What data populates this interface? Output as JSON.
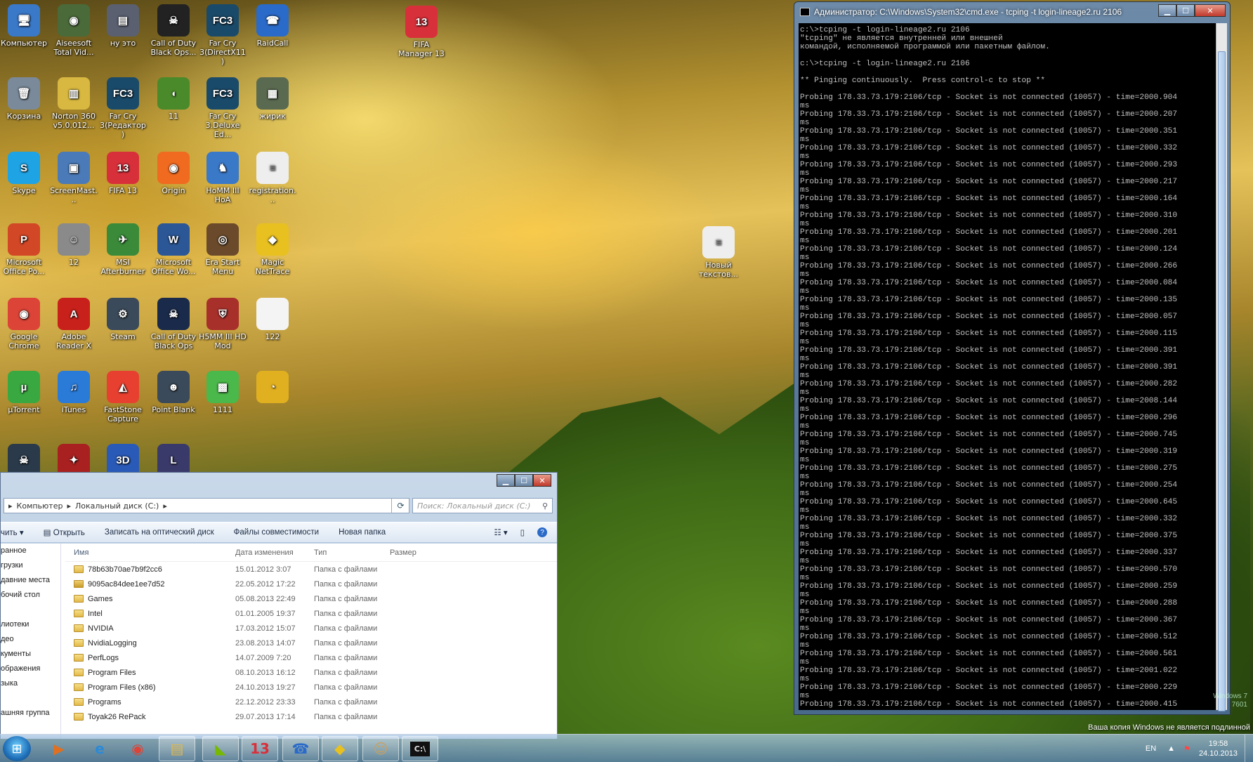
{
  "desktop_icons": [
    {
      "label": "Компьютер",
      "icon": "computer-icon",
      "color": "#3a78c8",
      "glyph": "🖥"
    },
    {
      "label": "Aiseesoft Total Vid...",
      "icon": "film-reel-icon",
      "color": "#4a6a3a",
      "glyph": "◉"
    },
    {
      "label": "ну это",
      "icon": "road-image-icon",
      "color": "#5a6070",
      "glyph": "▤"
    },
    {
      "label": "Call of Duty Black Ops...",
      "icon": "skull-icon",
      "color": "#222",
      "glyph": "☠"
    },
    {
      "label": "Far Cry 3(DirectX11)",
      "icon": "farcry3-icon",
      "color": "#1a4a6a",
      "glyph": "FC3"
    },
    {
      "label": "RaidCall",
      "icon": "raidcall-icon",
      "color": "#2a6ac8",
      "glyph": "☎"
    },
    {
      "label": "Корзина",
      "icon": "recycle-bin-icon",
      "color": "#7a8a9a",
      "glyph": "🗑"
    },
    {
      "label": "Norton 360 v5.0.012...",
      "icon": "norton-box-icon",
      "color": "#d8b840",
      "glyph": "▥"
    },
    {
      "label": "Far Cry 3(Редактор)",
      "icon": "farcry3-editor-icon",
      "color": "#1a4a6a",
      "glyph": "FC3"
    },
    {
      "label": "11",
      "icon": "cucumber-icon",
      "color": "#4a8a2a",
      "glyph": "◖"
    },
    {
      "label": "Far Cry 3.Deluxe Ed...",
      "icon": "farcry3-deluxe-icon",
      "color": "#1a4a6a",
      "glyph": "FC3"
    },
    {
      "label": "жирик",
      "icon": "photo-icon",
      "color": "#5a6a50",
      "glyph": "▦"
    },
    {
      "label": "Skype",
      "icon": "skype-icon",
      "color": "#1ea3e4",
      "glyph": "S"
    },
    {
      "label": "ScreenMast...",
      "icon": "screenmaster-icon",
      "color": "#4a7ab8",
      "glyph": "▣"
    },
    {
      "label": "FIFA 13",
      "icon": "fifa13-icon",
      "color": "#d8303a",
      "glyph": "13"
    },
    {
      "label": "Origin",
      "icon": "origin-icon",
      "color": "#f06a20",
      "glyph": "◉"
    },
    {
      "label": "HoMM III HoA",
      "icon": "homm3-icon",
      "color": "#3a78c8",
      "glyph": "♞"
    },
    {
      "label": "registration...",
      "icon": "text-file-icon",
      "color": "#eeeeee",
      "glyph": "≡"
    },
    {
      "label": "Microsoft Office Po...",
      "icon": "powerpoint-icon",
      "color": "#d24726",
      "glyph": "P"
    },
    {
      "label": "12",
      "icon": "portrait-icon",
      "color": "#8a8a8a",
      "glyph": "☺"
    },
    {
      "label": "MSI Afterburner",
      "icon": "msi-afterburner-icon",
      "color": "#3a8a3a",
      "glyph": "✈"
    },
    {
      "label": "Microsoft Office Wo...",
      "icon": "word-icon",
      "color": "#2b5797",
      "glyph": "W"
    },
    {
      "label": "Era Start Menu",
      "icon": "era-spiral-icon",
      "color": "#6a4a2a",
      "glyph": "◎"
    },
    {
      "label": "Magic NetTrace",
      "icon": "magic-nettrace-icon",
      "color": "#e8c020",
      "glyph": "◆"
    },
    {
      "label": "Google Chrome",
      "icon": "chrome-icon",
      "color": "#db4437",
      "glyph": "◉"
    },
    {
      "label": "Adobe Reader X",
      "icon": "adobe-reader-icon",
      "color": "#c8201a",
      "glyph": "A"
    },
    {
      "label": "Steam",
      "icon": "steam-icon",
      "color": "#3a4a5a",
      "glyph": "⚙"
    },
    {
      "label": "Call of Duty Black Ops",
      "icon": "skull-icon",
      "color": "#1a2a4a",
      "glyph": "☠"
    },
    {
      "label": "H5MM III HD Mod",
      "icon": "homm-shield-icon",
      "color": "#a8302a",
      "glyph": "⛨"
    },
    {
      "label": "122",
      "icon": "blank-file-icon",
      "color": "#f4f4f4",
      "glyph": ""
    },
    {
      "label": "µTorrent",
      "icon": "utorrent-icon",
      "color": "#3aa840",
      "glyph": "µ"
    },
    {
      "label": "iTunes",
      "icon": "itunes-icon",
      "color": "#2a7ad8",
      "glyph": "♫"
    },
    {
      "label": "FastStone Capture",
      "icon": "faststone-icon",
      "color": "#e84030",
      "glyph": "◭"
    },
    {
      "label": "Point Blank",
      "icon": "point-blank-icon",
      "color": "#3a4a5a",
      "glyph": "☻"
    },
    {
      "label": "1111",
      "icon": "image-icon",
      "color": "#4ab84a",
      "glyph": "▩"
    },
    {
      "label": "",
      "icon": "yellow-ring-icon",
      "color": "#e0b020",
      "glyph": "◔"
    },
    {
      "label": "",
      "icon": "soldier-icon",
      "color": "#2a3a4a",
      "glyph": "☠"
    },
    {
      "label": "",
      "icon": "red-game-icon",
      "color": "#a82020",
      "glyph": "✦"
    },
    {
      "label": "",
      "icon": "3d-game-icon",
      "color": "#2a5ab8",
      "glyph": "3D"
    },
    {
      "label": "",
      "icon": "lineage-icon",
      "color": "#3a3a6a",
      "glyph": "L"
    },
    {
      "label": "FIFA Manager 13",
      "icon": "fifa-manager-icon",
      "color": "#d8303a",
      "glyph": "13"
    },
    {
      "label": "Новый текстов...",
      "icon": "text-file-icon",
      "color": "#eeeeee",
      "glyph": "≡"
    }
  ],
  "cmd": {
    "title": "Администратор: C:\\Windows\\System32\\cmd.exe - tcping  -t login-lineage2.ru 2106",
    "header_lines": [
      "c:\\>tcping -t login-lineage2.ru 2106",
      "\"tcping\" не является внутренней или внешней",
      "командой, исполняемой программой или пакетным файлом.",
      "",
      "c:\\>tcping -t login-lineage2.ru 2106",
      "",
      "** Pinging continuously.  Press control-c to stop **",
      ""
    ],
    "probe_prefix": "Probing 178.33.73.179:2106/tcp - Socket is not connected (10057) - time=",
    "probe_times": [
      "2000.904",
      "2000.207",
      "2000.351",
      "2000.332",
      "2000.293",
      "2000.217",
      "2000.164",
      "2000.310",
      "2000.201",
      "2000.124",
      "2000.266",
      "2000.084",
      "2000.135",
      "2000.057",
      "2000.115",
      "2000.391",
      "2000.391",
      "2000.282",
      "2008.144",
      "2000.296",
      "2000.745",
      "2000.319",
      "2000.275",
      "2000.254",
      "2000.645",
      "2000.332",
      "2000.375",
      "2000.337",
      "2000.570",
      "2000.259",
      "2000.288",
      "2000.367",
      "2000.512",
      "2000.561",
      "2001.022",
      "2000.229",
      "2000.415"
    ],
    "probe_suffix": "ms"
  },
  "explorer": {
    "breadcrumb": [
      "Компьютер",
      "Локальный диск (C:)"
    ],
    "search_placeholder": "Поиск: Локальный диск (C:)",
    "toolbar": [
      "чить ▾",
      "Открыть",
      "Записать на оптический диск",
      "Файлы совместимости",
      "Новая папка"
    ],
    "nav": [
      "ранное",
      "грузки",
      "давние места",
      "бочий стол",
      "",
      "лиотеки",
      "део",
      "кументы",
      "ображения",
      "зыка",
      "",
      "ашняя группа"
    ],
    "columns": [
      "Имя",
      "Дата изменения",
      "Тип",
      "Размер"
    ],
    "rows": [
      {
        "name": "78b63b70ae7b9f2cc6",
        "date": "15.01.2012 3:07",
        "type": "Папка с файлами"
      },
      {
        "name": "9095ac84dee1ee7d52",
        "date": "22.05.2012 17:22",
        "type": "Папка с файлами"
      },
      {
        "name": "Games",
        "date": "05.08.2013 22:49",
        "type": "Папка с файлами"
      },
      {
        "name": "Intel",
        "date": "01.01.2005 19:37",
        "type": "Папка с файлами"
      },
      {
        "name": "NVIDIA",
        "date": "17.03.2012 15:07",
        "type": "Папка с файлами"
      },
      {
        "name": "NvidiaLogging",
        "date": "23.08.2013 14:07",
        "type": "Папка с файлами"
      },
      {
        "name": "PerfLogs",
        "date": "14.07.2009 7:20",
        "type": "Папка с файлами"
      },
      {
        "name": "Program Files",
        "date": "08.10.2013 16:12",
        "type": "Папка с файлами"
      },
      {
        "name": "Program Files (x86)",
        "date": "24.10.2013 19:27",
        "type": "Папка с файлами"
      },
      {
        "name": "Programs",
        "date": "22.12.2012 23:33",
        "type": "Папка с файлами"
      },
      {
        "name": "Toyak26 RePack",
        "date": "29.07.2013 17:14",
        "type": "Папка с файлами"
      }
    ]
  },
  "taskbar": {
    "buttons": [
      {
        "icon": "media-player-icon",
        "glyph": "▶",
        "color": "#e07020"
      },
      {
        "icon": "internet-explorer-icon",
        "glyph": "e",
        "color": "#2a8ad8"
      },
      {
        "icon": "chrome-icon",
        "glyph": "◉",
        "color": "#db4437"
      },
      {
        "icon": "explorer-folder-icon",
        "glyph": "▤",
        "color": "#e0b84a"
      },
      {
        "icon": "nvidia-icon",
        "glyph": "◣",
        "color": "#76b900"
      },
      {
        "icon": "fifa13-icon",
        "glyph": "13",
        "color": "#d8303a"
      },
      {
        "icon": "raidcall-icon",
        "glyph": "☎",
        "color": "#2a6ac8"
      },
      {
        "icon": "magic-nettrace-icon",
        "glyph": "◆",
        "color": "#e8c020"
      },
      {
        "icon": "game-character-icon",
        "glyph": "☺",
        "color": "#c8a060"
      },
      {
        "icon": "cmd-icon",
        "glyph": "C:\\",
        "color": "#111"
      }
    ],
    "lang": "EN",
    "time": "19:58",
    "date": "24.10.2013"
  },
  "watermark": "Ваша копия Windows не является подлинной",
  "watermark_small": "Windows 7\n7601"
}
